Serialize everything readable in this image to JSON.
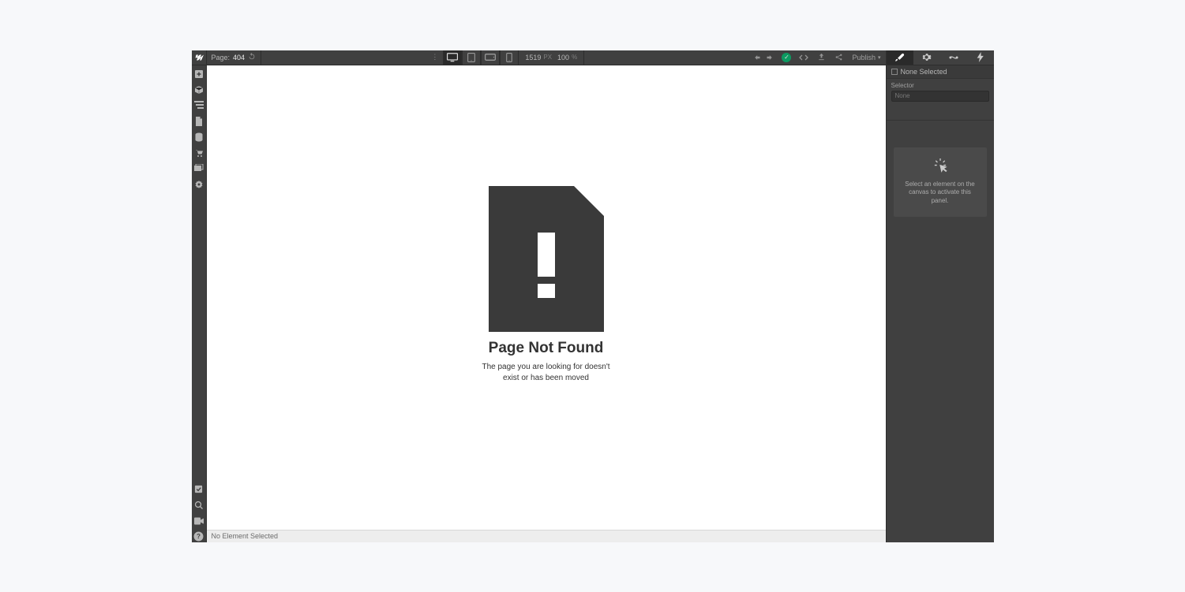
{
  "topbar": {
    "page_label": "Page:",
    "page_name": "404",
    "width_value": "1519",
    "width_unit": "PX",
    "zoom_value": "100",
    "zoom_unit": "%",
    "publish_label": "Publish"
  },
  "canvas": {
    "heading": "Page Not Found",
    "body": "The page you are looking for doesn't exist or has been moved"
  },
  "breadcrumb": {
    "text": "No Element Selected"
  },
  "rightpanel": {
    "none_selected": "None Selected",
    "selector_label": "Selector",
    "selector_placeholder": "None",
    "empty_hint": "Select an element on the canvas to activate this panel."
  }
}
